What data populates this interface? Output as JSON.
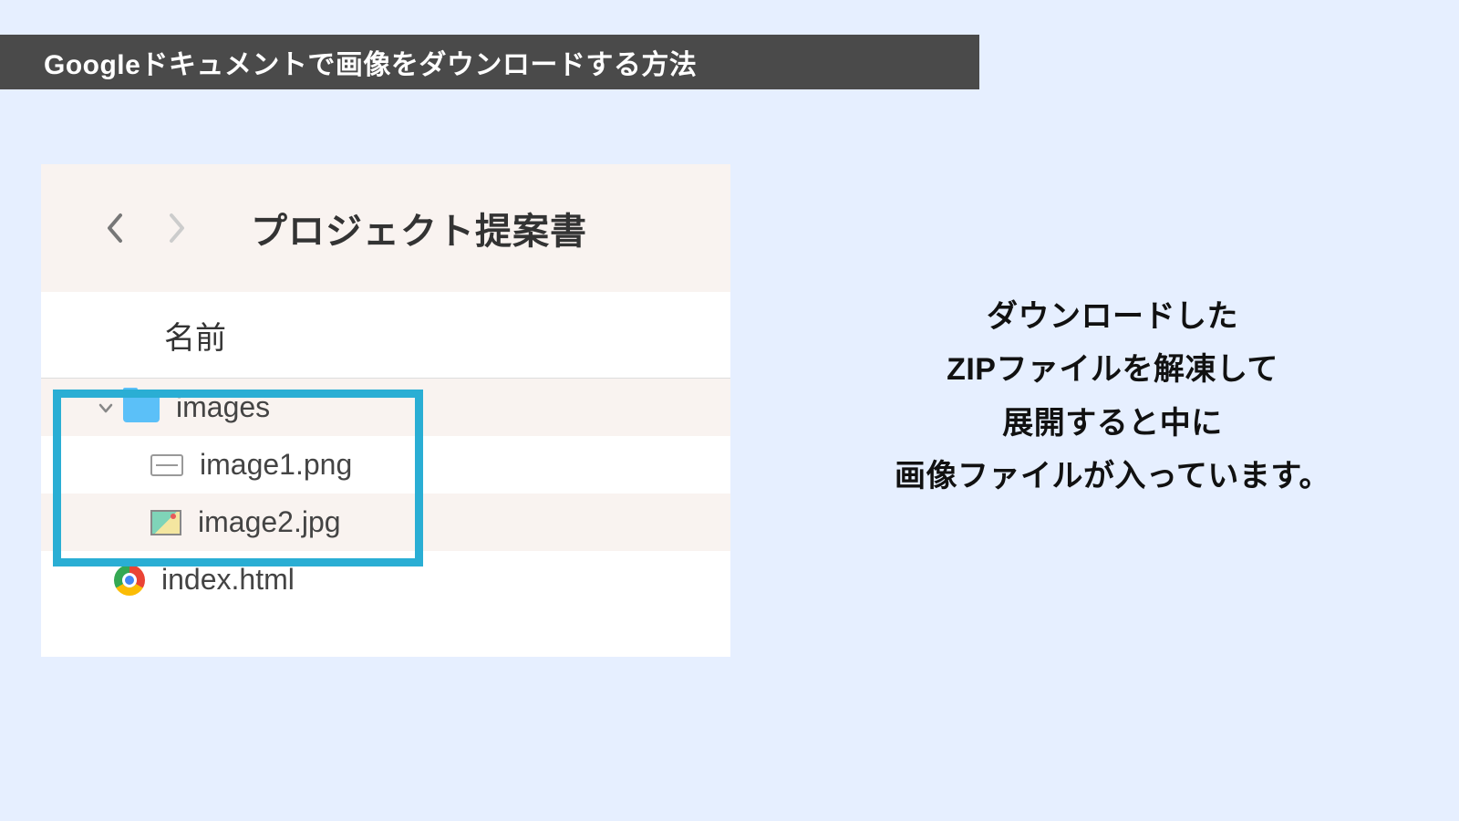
{
  "title": "Googleドキュメントで画像をダウンロードする方法",
  "browser": {
    "folder_title": "プロジェクト提案書",
    "name_column": "名前",
    "files": {
      "images_folder": "images",
      "image1": "image1.png",
      "image2": "image2.jpg",
      "index": "index.html"
    }
  },
  "explanation": {
    "line1": "ダウンロードした",
    "line2": "ZIPファイルを解凍して",
    "line3": "展開すると中に",
    "line4": "画像ファイルが入っています。"
  }
}
